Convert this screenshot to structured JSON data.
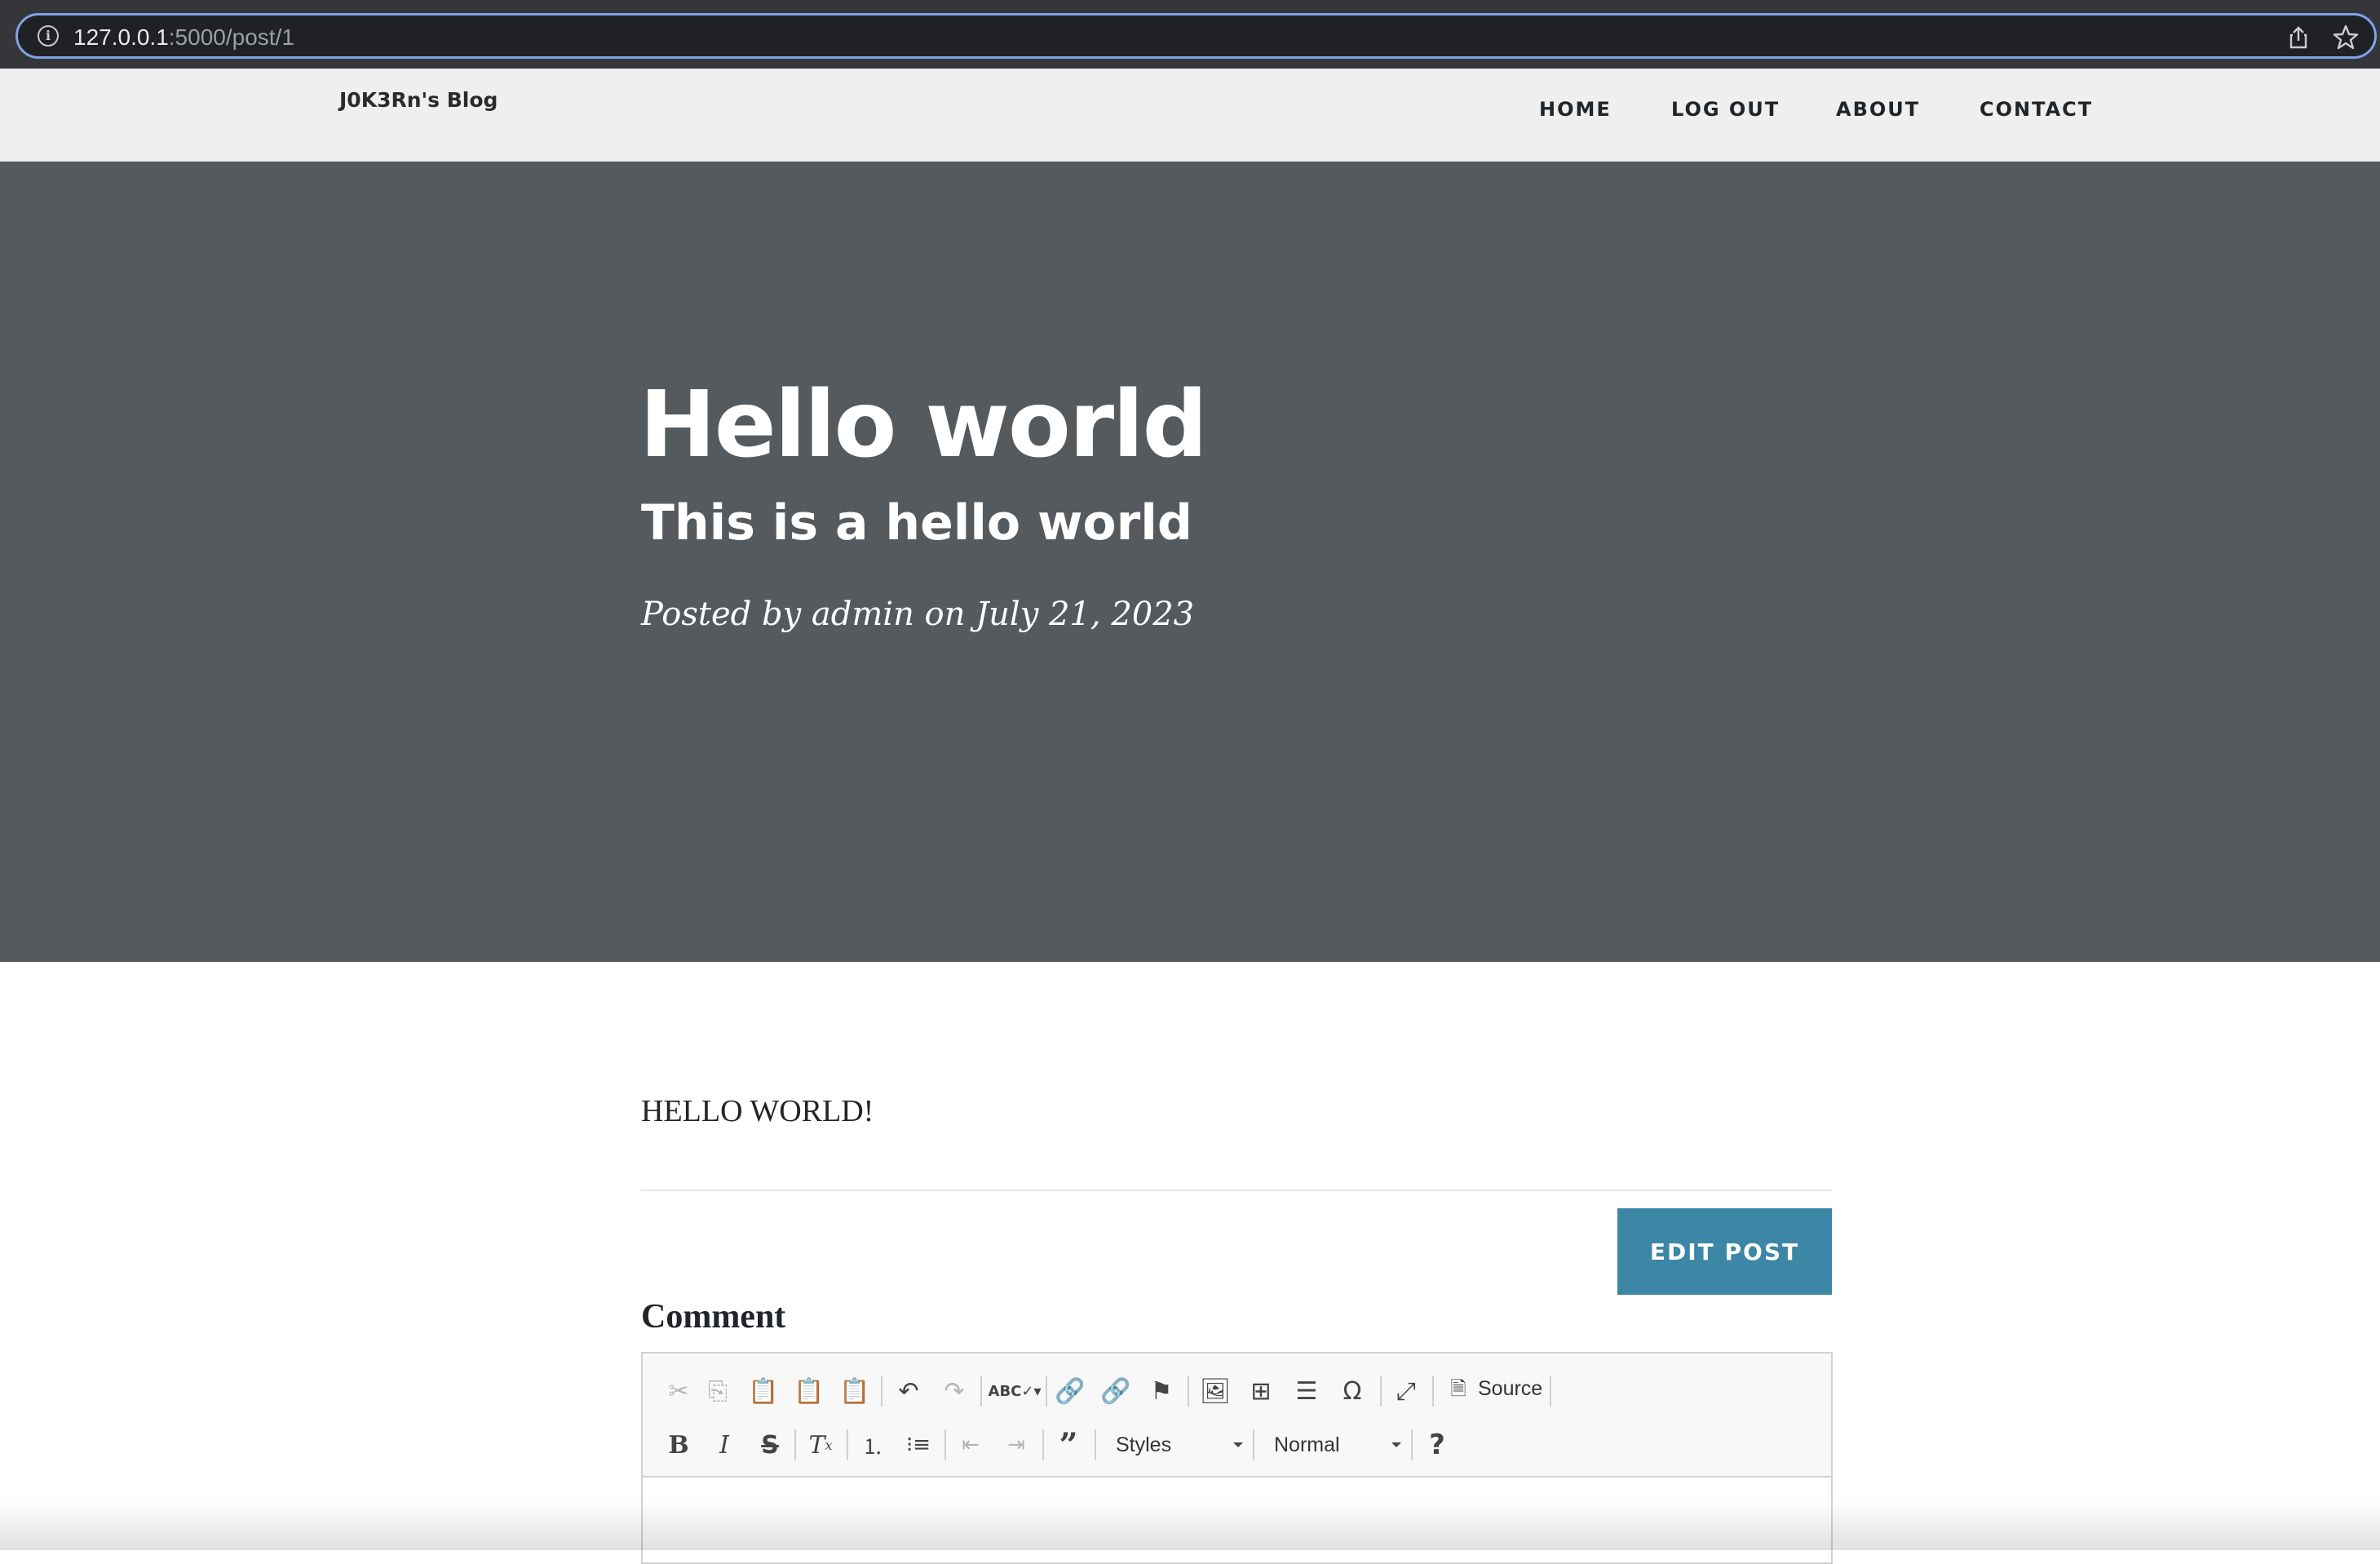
{
  "browser": {
    "url_host": "127.0.0.1",
    "url_path": ":5000/post/1"
  },
  "navbar": {
    "brand": "J0K3Rn's Blog",
    "links": [
      {
        "label": "HOME"
      },
      {
        "label": "LOG OUT"
      },
      {
        "label": "ABOUT"
      },
      {
        "label": "CONTACT"
      }
    ]
  },
  "post": {
    "title": "Hello world",
    "subtitle": "This is a hello world",
    "meta": "Posted by admin on July 21, 2023",
    "body": "HELLO WORLD!",
    "edit_label": "EDIT POST"
  },
  "comment": {
    "label": "Comment",
    "toolbar": {
      "source_label": "Source",
      "styles_label": "Styles",
      "format_label": "Normal",
      "help_label": "?"
    }
  },
  "colors": {
    "hero_bg": "#555a5f",
    "navbar_bg": "#eeefee",
    "edit_button": "#3c86a6"
  }
}
